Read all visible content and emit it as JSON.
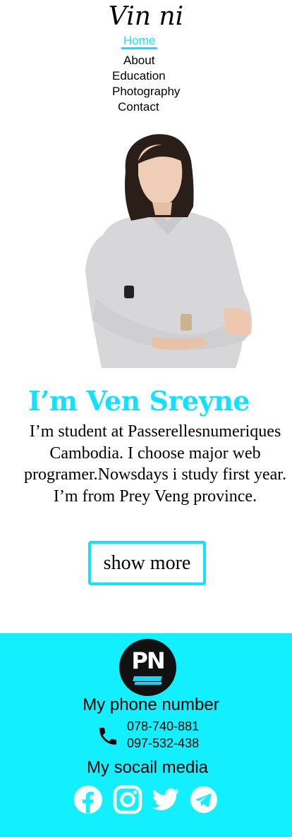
{
  "header": {
    "logo": "Vin ni",
    "nav": [
      {
        "label": "Home",
        "active": true
      },
      {
        "label": "About",
        "active": false
      },
      {
        "label": "Education",
        "active": false
      },
      {
        "label": "Photography",
        "active": false
      },
      {
        "label": "Contact",
        "active": false
      }
    ]
  },
  "hero": {
    "name": "I’m Ven Sreyne",
    "bio": "I’m student at Passerellesnumeriques Cambodia. I choose major web programer.Nowsdays i study first year. I’m from Prey Veng province.",
    "button_label": "show more",
    "photo": "portrait-photo"
  },
  "footer": {
    "logo_text": "PN",
    "phone_title": "My phone number",
    "phones": [
      "078-740-881",
      "097-532-438"
    ],
    "social_title": "My socail media",
    "social_icons": [
      "facebook-icon",
      "instagram-icon",
      "twitter-icon",
      "telegram-icon"
    ]
  },
  "colors": {
    "accent": "#12e2ff",
    "footer_bg": "#12f0ff",
    "text": "#000000",
    "background": "#ffffff"
  }
}
